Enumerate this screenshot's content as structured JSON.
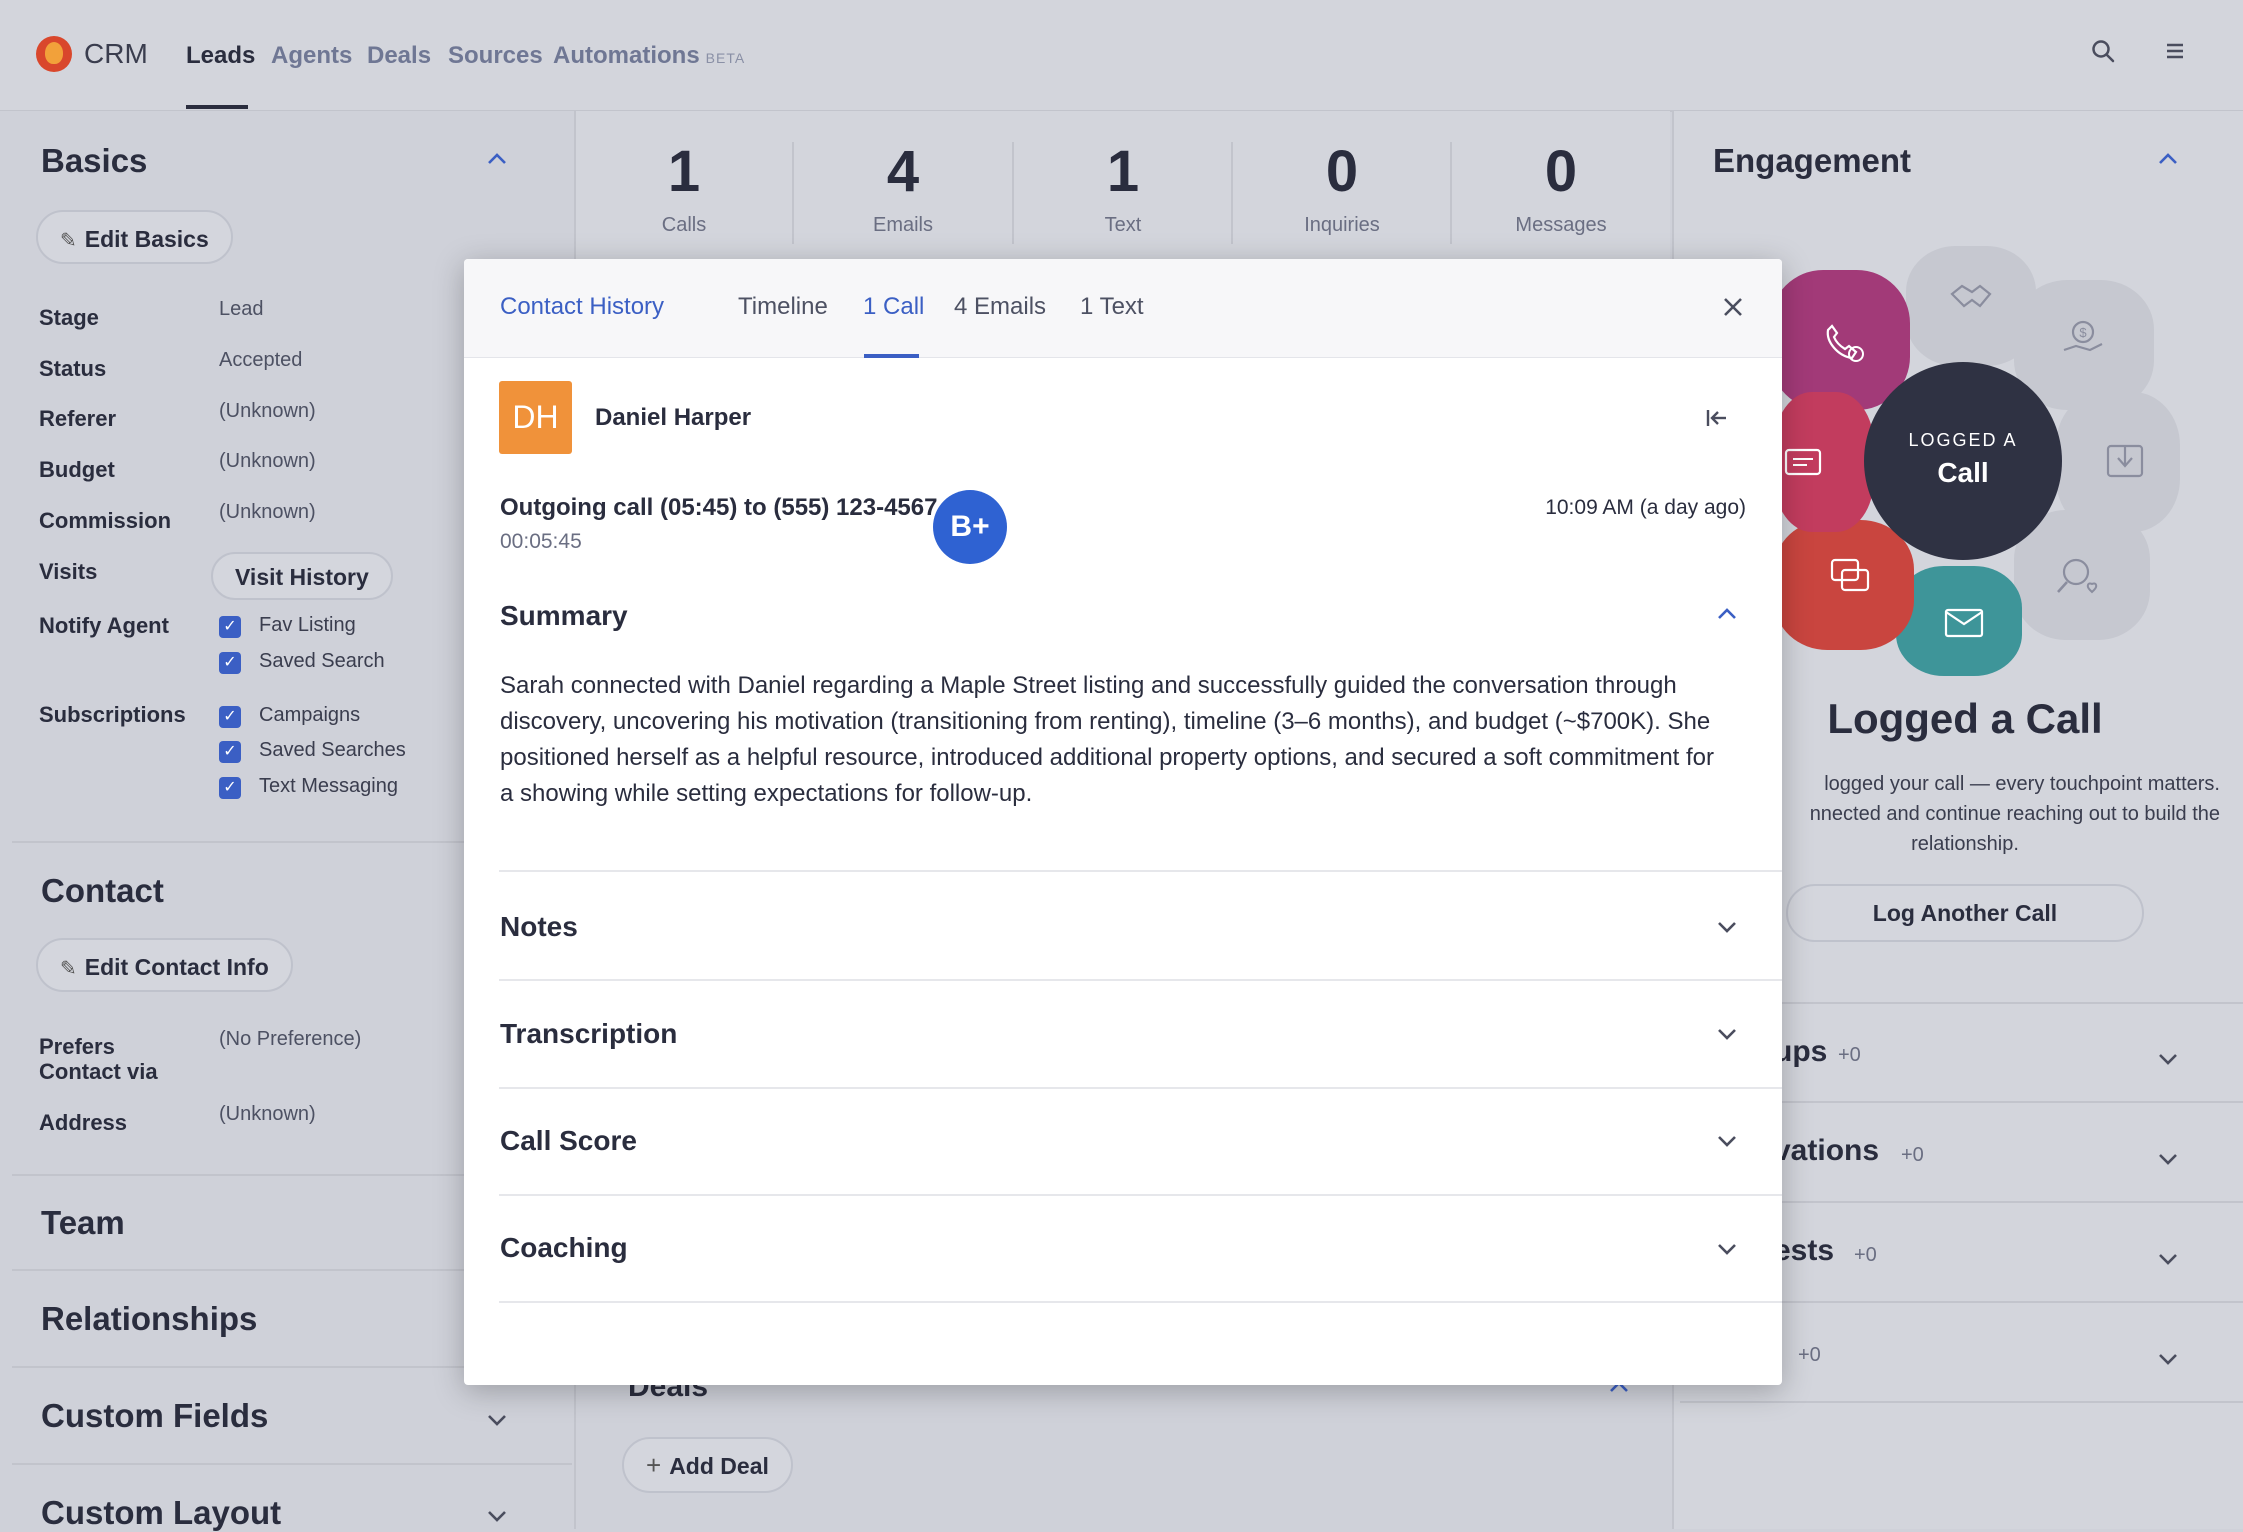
{
  "nav": {
    "brand": "CRM",
    "items": [
      "Leads",
      "Agents",
      "Deals",
      "Sources",
      "Automations"
    ],
    "beta": "BETA",
    "active": "Leads"
  },
  "basics": {
    "title": "Basics",
    "edit_button": "Edit Basics",
    "fields": [
      {
        "label": "Stage",
        "value": "Lead"
      },
      {
        "label": "Status",
        "value": "Accepted"
      },
      {
        "label": "Referer",
        "value": "(Unknown)"
      },
      {
        "label": "Budget",
        "value": "(Unknown)"
      },
      {
        "label": "Commission",
        "value": "(Unknown)"
      }
    ],
    "visits_label": "Visits",
    "visit_history_button": "Visit History",
    "notify_label": "Notify Agent",
    "notify_options": [
      "Fav Listing",
      "Saved Search"
    ],
    "subscriptions_label": "Subscriptions",
    "subscription_options": [
      "Campaigns",
      "Saved Searches",
      "Text Messaging"
    ]
  },
  "contact": {
    "title": "Contact",
    "edit_button": "Edit Contact Info",
    "prefers_label_1": "Prefers",
    "prefers_label_2": "Contact via",
    "prefers_value": "(No Preference)",
    "address_label": "Address",
    "address_value": "(Unknown)"
  },
  "left_sections": [
    "Team",
    "Relationships",
    "Custom Fields",
    "Custom Layout"
  ],
  "stats": [
    {
      "value": "1",
      "label": "Calls"
    },
    {
      "value": "4",
      "label": "Emails"
    },
    {
      "value": "1",
      "label": "Text"
    },
    {
      "value": "0",
      "label": "Inquiries"
    },
    {
      "value": "0",
      "label": "Messages"
    }
  ],
  "deals": {
    "title": "Deals",
    "add_button": "Add Deal"
  },
  "engagement": {
    "title": "Engagement",
    "dial_top": "LOGGED A",
    "dial_main": "Call",
    "headline": "Logged a Call",
    "message_1": "logged your call — every touchpoint matters.",
    "message_2": "nnected and continue reaching out to build the",
    "message_3": "relationship.",
    "log_button": "Log Another Call",
    "collapsed": [
      {
        "label": "ups",
        "count": "+0"
      },
      {
        "label": "vations",
        "count": "+0"
      },
      {
        "label": "ests",
        "count": "+0"
      },
      {
        "label": "",
        "count": "+0"
      }
    ]
  },
  "modal": {
    "tabs": [
      "Contact History",
      "Timeline",
      "1 Call",
      "4 Emails",
      "1 Text"
    ],
    "active_tab": "1 Call",
    "avatar_initials": "DH",
    "contact_name": "Daniel Harper",
    "call_title": "Outgoing call (05:45) to (555) 123-4567",
    "call_duration": "00:05:45",
    "call_time": "10:09 AM (a day ago)",
    "grade": "B+",
    "summary_title": "Summary",
    "summary_text": "Sarah connected with Daniel regarding a Maple Street listing and successfully guided the conversation through discovery, uncovering his motivation (transitioning from renting), timeline (3–6 months), and budget (~$700K). She positioned herself as a helpful resource, introduced additional property options, and secured a soft commitment for a showing while setting expectations for follow-up.",
    "sections": [
      "Notes",
      "Transcription",
      "Call Score",
      "Coaching"
    ]
  },
  "colors": {
    "accent": "#3b5fc4",
    "avatar": "#f0923a",
    "grade": "#2f62d2",
    "dial": "#2f3243",
    "petal_magenta": "#a23a78",
    "petal_pink": "#c23c5e",
    "petal_red": "#c9453f",
    "petal_teal": "#3e9599",
    "petal_grey": "#c6c8d0"
  },
  "icons": [
    "search-icon",
    "menu-icon",
    "chevron-up-icon",
    "chevron-down-icon",
    "close-icon",
    "collapse-left-icon",
    "pencil-icon",
    "plus-icon",
    "check-icon"
  ]
}
